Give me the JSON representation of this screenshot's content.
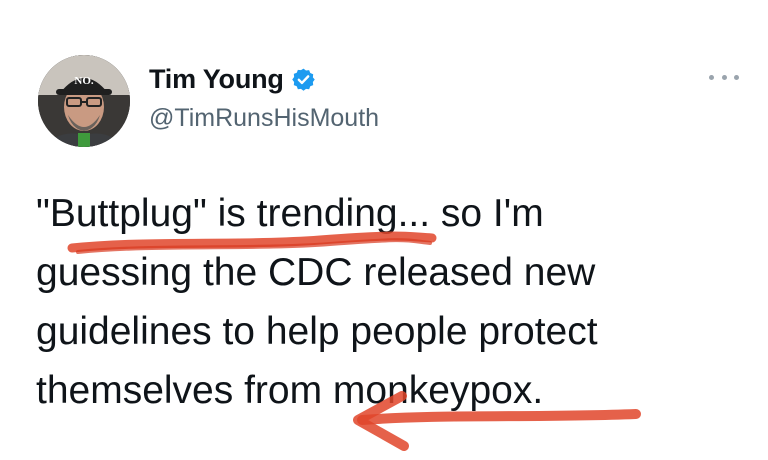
{
  "tweet": {
    "display_name": "Tim Young",
    "handle": "@TimRunsHisMouth",
    "verified": true,
    "avatar_hat_text": "NO.",
    "text_lines": [
      "\"Buttplug\" is trending... so I'm",
      "guessing the CDC released new",
      "guidelines to help people protect",
      "themselves from monkeypox."
    ]
  },
  "colors": {
    "verified_badge": "#1d9bf0",
    "annotation_marker": "#e0452a",
    "text_primary": "#0f1419",
    "text_secondary": "#536471"
  },
  "icons": {
    "verified": "verified-badge-icon",
    "more": "more-horizontal-icon"
  }
}
